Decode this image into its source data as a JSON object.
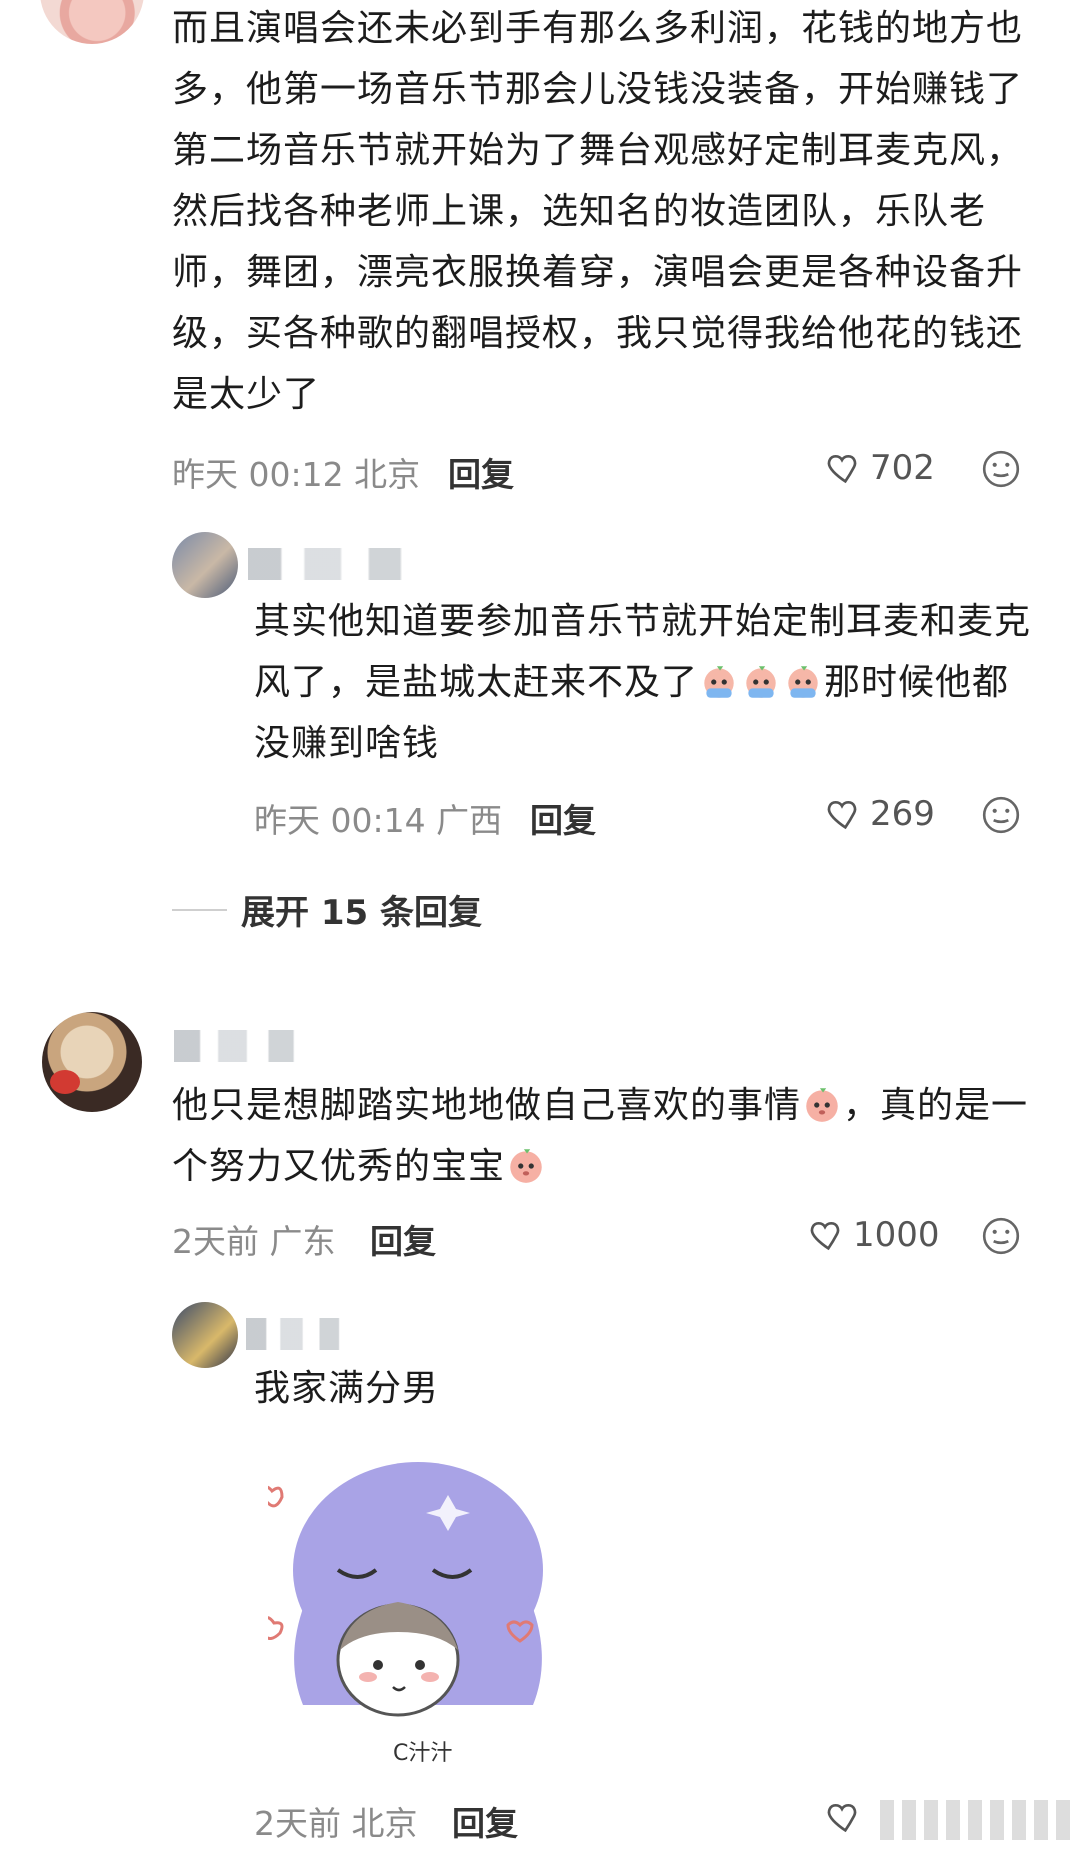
{
  "comments": [
    {
      "text": "而且演唱会还未必到手有那么多利润，花钱的地方也多，他第一场音乐节那会儿没钱没装备，开始赚钱了第二场音乐节就开始为了舞台观感好定制耳麦克风，然后找各种老师上课，选知名的妆造团队，乐队老师，舞团，漂亮衣服换着穿，演唱会更是各种设备升级，买各种歌的翻唱授权，我只觉得我给他花的钱还是太少了",
      "meta": "昨天 00:12 北京",
      "reply_label": "回复",
      "likes": "702"
    },
    {
      "text_before": "其实他知道要参加音乐节就开始定制耳麦和麦克风了，是盐城太赶来不及了",
      "text_after": "那时候他都没赚到啥钱",
      "meta": "昨天 00:14 广西",
      "reply_label": "回复",
      "likes": "269"
    },
    {
      "expand_label": "展开 15 条回复"
    },
    {
      "text_a": "他只是想脚踏实地地做自己喜欢的事情",
      "text_b": "，真的是一个努力又优秀的宝宝",
      "meta": "2天前 广东",
      "reply_label": "回复",
      "likes": "1000"
    },
    {
      "text": "我家满分男",
      "meta": "2天前 北京",
      "reply_label": "回复",
      "sticker_signature": "C汁汁"
    }
  ],
  "icons": {
    "like": "heart-outline-icon",
    "emote": "smile-face-icon"
  },
  "colors": {
    "text": "#1c1c1c",
    "meta": "#8a8a8a",
    "sticker": "#a9a3e6"
  }
}
